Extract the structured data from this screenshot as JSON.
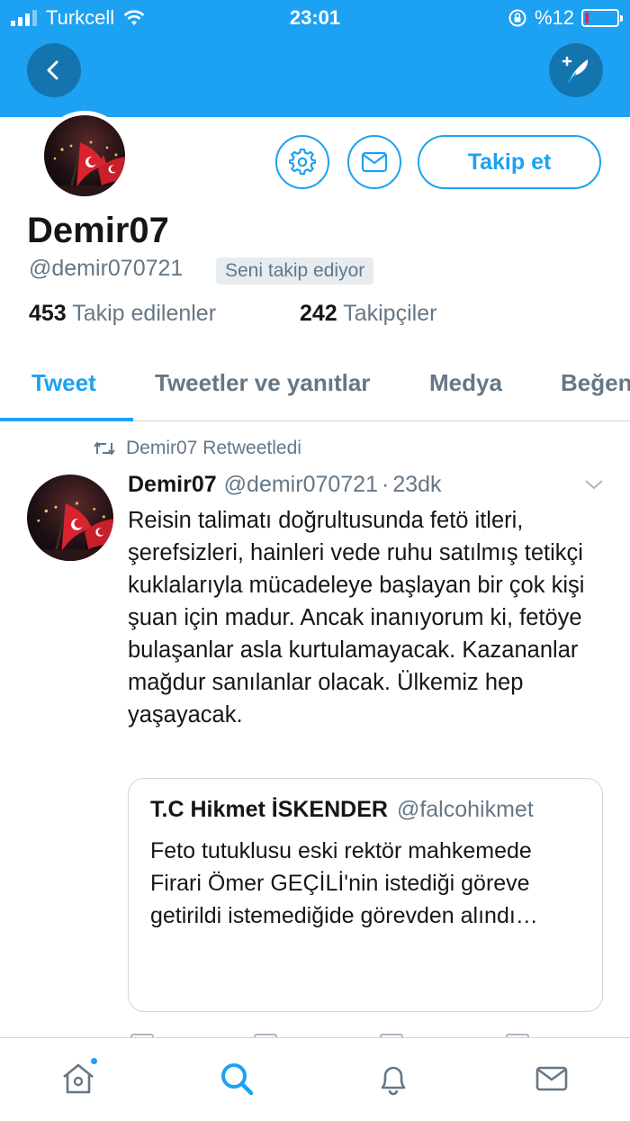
{
  "status_bar": {
    "carrier": "Turkcell",
    "time": "23:01",
    "battery": "%12",
    "battery_level": 0.12
  },
  "profile": {
    "name": "Demir07",
    "handle": "@demir070721",
    "follows_you": "Seni takip ediyor",
    "following_count": "453",
    "following_label": "Takip edilenler",
    "followers_count": "242",
    "followers_label": "Takipçiler",
    "follow_button": "Takip et"
  },
  "tabs": [
    {
      "label": "Tweet",
      "active": true
    },
    {
      "label": "Tweetler ve yanıtlar",
      "active": false
    },
    {
      "label": "Medya",
      "active": false
    },
    {
      "label": "Beğen",
      "active": false
    }
  ],
  "tweet": {
    "retweet_label": "Demir07 Retweetledi",
    "author_name": "Demir07",
    "author_handle": "@demir070721",
    "separator": "·",
    "time": "23dk",
    "text": "Reisin talimatı doğrultusunda fetö itleri, şerefsizleri, hainleri vede ruhu satılmış tetikçi  kuklalarıyla mücadeleye başlayan bir çok kişi şuan için madur. Ancak inanıyorum ki, fetöye bulaşanlar asla kurtulamayacak. Kazananlar mağdur sanılanlar olacak. Ülkemiz hep yaşayacak.",
    "quote": {
      "author_name": "T.C Hikmet İSKENDER",
      "author_handle": "@falcohikmet",
      "text": "Feto tutuklusu eski rektör mahkemede\nFirari Ömer GEÇİLİ'nin istediği göreve getirildi istemediğide görevden alındı…"
    }
  },
  "colors": {
    "brand": "#1da1f2",
    "text": "#14171a",
    "muted": "#657786"
  },
  "icons": {
    "back": "back-arrow-icon",
    "compose": "compose-tweet-icon",
    "settings": "gear-icon",
    "message": "envelope-icon",
    "home": "home-icon",
    "search": "search-icon",
    "notifications": "bell-icon",
    "messages": "envelope-icon"
  }
}
